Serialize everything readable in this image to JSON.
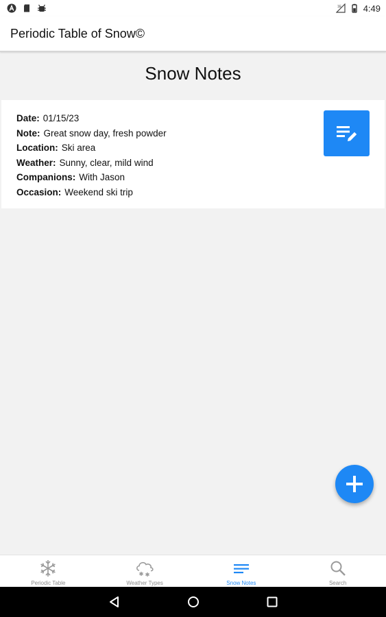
{
  "status_bar": {
    "time": "4:49",
    "left_icons": [
      "app-a-icon",
      "sd-card-icon",
      "android-debug-icon"
    ],
    "right_icons": [
      "no-signal-icon",
      "battery-icon"
    ]
  },
  "app_bar": {
    "title": "Periodic Table of Snow©"
  },
  "page": {
    "title": "Snow Notes"
  },
  "note": {
    "fields": [
      {
        "key": "Date:",
        "value": "01/15/23"
      },
      {
        "key": "Note:",
        "value": "Great snow day, fresh powder"
      },
      {
        "key": "Location:",
        "value": "Ski area"
      },
      {
        "key": "Weather:",
        "value": "Sunny, clear, mild wind"
      },
      {
        "key": "Companions:",
        "value": "With Jason"
      },
      {
        "key": "Occasion:",
        "value": "Weekend ski trip"
      }
    ],
    "edit_icon": "edit-note-icon"
  },
  "fab": {
    "icon": "plus-icon"
  },
  "bottom_nav": {
    "items": [
      {
        "label": "Periodic Table",
        "icon": "snowflake-icon",
        "active": false
      },
      {
        "label": "Weather Types",
        "icon": "snow-cloud-icon",
        "active": false
      },
      {
        "label": "Snow Notes",
        "icon": "notes-lines-icon",
        "active": true
      },
      {
        "label": "Search",
        "icon": "search-icon",
        "active": false
      }
    ]
  },
  "colors": {
    "accent": "#1e88f5",
    "inactive": "#8a8a8a",
    "background": "#f2f2f2"
  }
}
